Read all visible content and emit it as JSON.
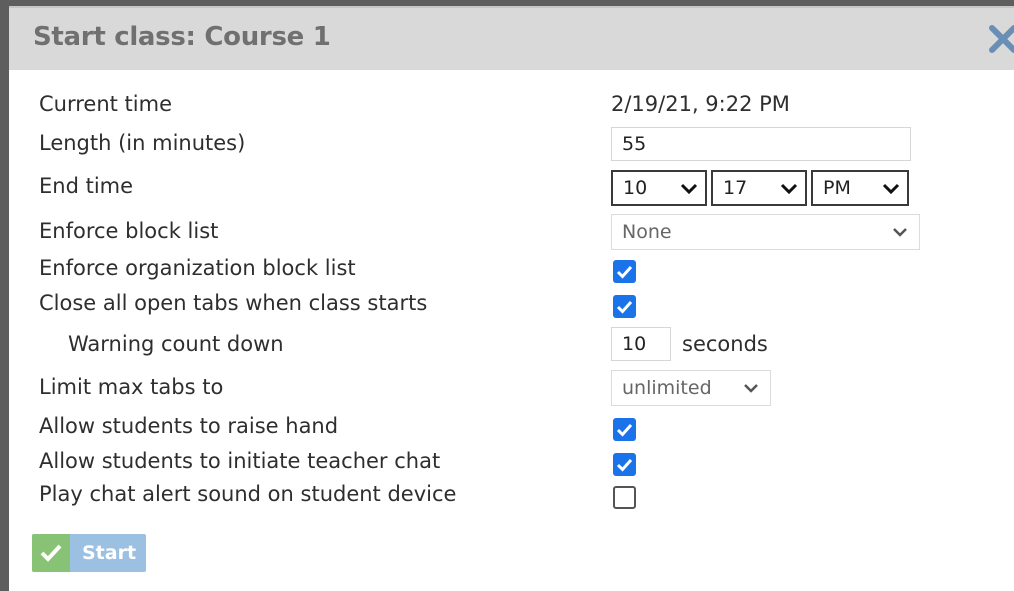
{
  "dialog": {
    "title": "Start class: Course 1"
  },
  "current_time": {
    "label": "Current time",
    "value": "2/19/21, 9:22 PM"
  },
  "length": {
    "label": "Length (in minutes)",
    "value": "55"
  },
  "end_time": {
    "label": "End time",
    "hour": "10",
    "minute": "17",
    "ampm": "PM"
  },
  "block_list": {
    "label": "Enforce block list",
    "value": "None"
  },
  "org_block_list": {
    "label": "Enforce organization block list",
    "checked": true
  },
  "close_tabs": {
    "label": "Close all open tabs when class starts",
    "checked": true
  },
  "warning": {
    "label": "Warning count down",
    "value": "10",
    "unit": "seconds"
  },
  "max_tabs": {
    "label": "Limit max tabs to",
    "value": "unlimited"
  },
  "raise_hand": {
    "label": "Allow students to raise hand",
    "checked": true
  },
  "teacher_chat": {
    "label": "Allow students to initiate teacher chat",
    "checked": true
  },
  "chat_sound": {
    "label": "Play chat alert sound on student device",
    "checked": false
  },
  "start_button": {
    "label": "Start"
  },
  "colors": {
    "checkbox_on": "#1a73e8",
    "start_button": "#9cc0e2",
    "start_check": "#88c274",
    "title": "#707070"
  }
}
